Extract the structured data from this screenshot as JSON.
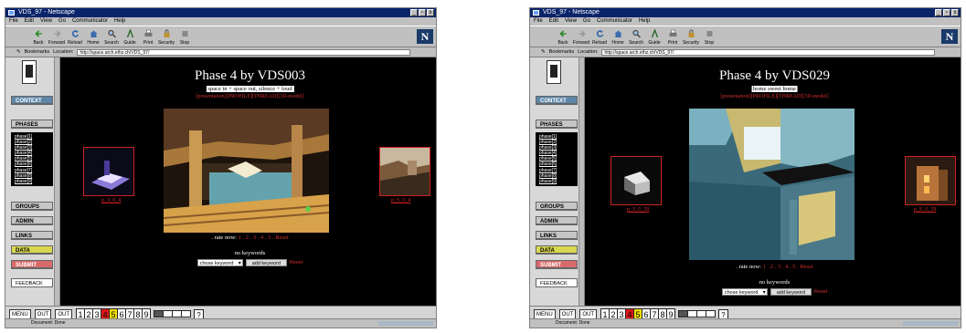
{
  "windows": [
    {
      "app_title": "VDS_97 - Netscape",
      "title_controls": [
        "_",
        "▫",
        "x"
      ],
      "menu": [
        "File",
        "Edit",
        "View",
        "Go",
        "Communicator",
        "Help"
      ],
      "toolbar": [
        "Back",
        "Forward",
        "Reload",
        "Home",
        "Search",
        "Guide",
        "Print",
        "Security",
        "Stop"
      ],
      "bookmarks_label": "Bookmarks",
      "location_label": "Location:",
      "url": "http://space.arch.ethz.ch/VDS_97/",
      "nav": {
        "context": "CONTEXT",
        "phases": "PHASES",
        "phase_items": [
          "phase[1]",
          "phase[2]",
          "phase[3]",
          "phase[4]",
          "phase[5]",
          "phase[6]",
          "phase[7]",
          "phase[8]",
          "phase[9]"
        ],
        "groups": "GROUPS",
        "admin": "ADMIN",
        "links": "LINKS",
        "data": "DATA",
        "submit": "SUBMIT",
        "feedback": "FEEDBACK"
      },
      "page": {
        "title": "Phase 4 by VDS003",
        "subtitle": "space in + space out, silence + loud",
        "links": "[presentation][PROFILE][THREAD][3D-model]",
        "thumb_left_caption": "p_3_0_4",
        "thumb_right_caption": "p_5_0_4",
        "rate_prefix": ". rate now:",
        "rate_values": "1 . 2 . 3 . 4 . 5 .",
        "rate_reset": "Reset",
        "no_keywords": "no keywords",
        "keyword_select": "chose keyword",
        "add_keyword": "add keyword",
        "keyword_reset": "Reset"
      },
      "bottombar": {
        "menu": "MENU",
        "out1": "OUT",
        "out2": "OUT",
        "numbers": [
          "1",
          "2",
          "3",
          "4",
          "5",
          "6",
          "7",
          "8",
          "9"
        ],
        "help": "?"
      },
      "status_text": "Document: Done"
    },
    {
      "app_title": "VDS_97 - Netscape",
      "title_controls": [
        "_",
        "▫",
        "x"
      ],
      "menu": [
        "File",
        "Edit",
        "View",
        "Go",
        "Communicator",
        "Help"
      ],
      "toolbar": [
        "Back",
        "Forward",
        "Reload",
        "Home",
        "Search",
        "Guide",
        "Print",
        "Security",
        "Stop"
      ],
      "bookmarks_label": "Bookmarks",
      "location_label": "Location:",
      "url": "http://space.arch.ethz.ch/VDS_97/",
      "nav": {
        "context": "CONTEXT",
        "phases": "PHASES",
        "phase_items": [
          "phase[1]",
          "phase[2]",
          "phase[3]",
          "phase[4]",
          "phase[5]",
          "phase[6]",
          "phase[7]",
          "phase[8]",
          "phase[9]"
        ],
        "groups": "GROUPS",
        "admin": "ADMIN",
        "links": "LINKS",
        "data": "DATA",
        "submit": "SUBMIT",
        "feedback": "FEEDBACK"
      },
      "page": {
        "title": "Phase 4 by VDS029",
        "subtitle": "home sweet home",
        "links": "[presentation][PROFILE][THREAD][3D-model]",
        "thumb_left_caption": "p_3_0_29",
        "thumb_right_caption": "p_5_0_29",
        "rate_prefix": ". rate now:",
        "rate_values": "1 . 2 . 3 . 4 . 5 .",
        "rate_reset": "Reset",
        "no_keywords": "no keywords",
        "keyword_select": "chose keyword",
        "add_keyword": "add keyword",
        "keyword_reset": "Reset"
      },
      "bottombar": {
        "menu": "MENU",
        "out1": "OUT",
        "out2": "OUT",
        "numbers": [
          "1",
          "2",
          "3",
          "4",
          "5",
          "6",
          "7",
          "8",
          "9"
        ],
        "help": "?"
      },
      "status_text": "Document: Done"
    }
  ]
}
